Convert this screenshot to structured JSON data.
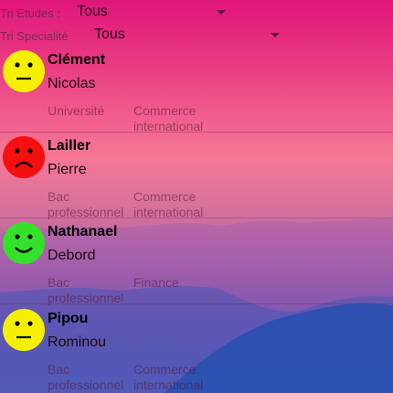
{
  "filters": {
    "etudes": {
      "label": "Tri Etudes :",
      "value": "Tous"
    },
    "specialite": {
      "label": "Tri Specialité",
      "value": "Tous"
    }
  },
  "students": [
    {
      "nom": "Clément",
      "prenom": "Nicolas",
      "etudes": "Université",
      "specialite": "Commerce international",
      "mood": "neutral",
      "color": "#f5f003"
    },
    {
      "nom": "Lailler",
      "prenom": "Pierre",
      "etudes": "Bac professionnel",
      "specialite": "Commerce international",
      "mood": "sad",
      "color": "#f4100f"
    },
    {
      "nom": "Nathanael",
      "prenom": "Debord",
      "etudes": "Bac professionnel",
      "specialite": "Finance",
      "mood": "happy",
      "color": "#35e02a"
    },
    {
      "nom": "Pipou",
      "prenom": "Rominou",
      "etudes": "Bac professionnel",
      "specialite": "Commerce international",
      "mood": "neutral",
      "color": "#f5f003"
    }
  ]
}
